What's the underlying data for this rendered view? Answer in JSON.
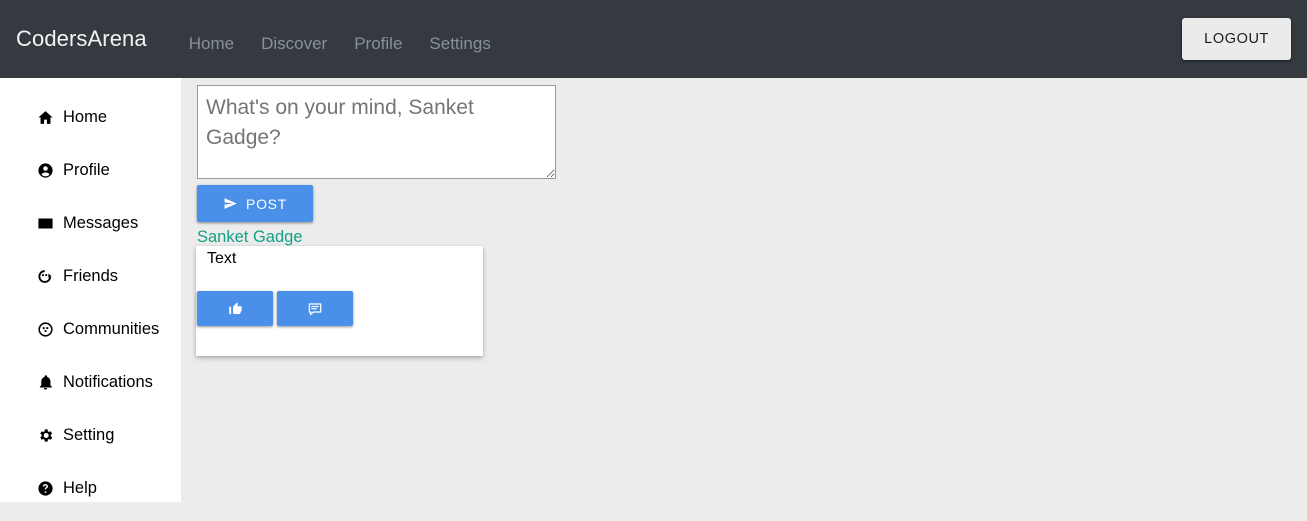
{
  "navbar": {
    "brand": "CodersArena",
    "links": [
      {
        "label": "Home",
        "icon": "none"
      },
      {
        "label": "Discover",
        "icon": "none"
      },
      {
        "label": "Profile",
        "icon": "none"
      },
      {
        "label": "Settings",
        "icon": "none"
      }
    ],
    "logout_label": "LOGOUT",
    "background_color": "#343a40",
    "link_color": "#8a9099",
    "brand_color": "#f2f3f4"
  },
  "sidebar": {
    "items": [
      {
        "label": "Home",
        "icon": "home-icon"
      },
      {
        "label": "Profile",
        "icon": "account-circle-icon"
      },
      {
        "label": "Messages",
        "icon": "envelope-icon"
      },
      {
        "label": "Friends",
        "icon": "friends-icon"
      },
      {
        "label": "Communities",
        "icon": "communities-icon"
      },
      {
        "label": "Notifications",
        "icon": "bell-icon"
      },
      {
        "label": "Setting",
        "icon": "gear-icon"
      },
      {
        "label": "Help",
        "icon": "help-circle-icon"
      }
    ],
    "background_color": "#ffffff"
  },
  "composer": {
    "placeholder": "What's on your mind, Sanket Gadge?",
    "value": "",
    "post_button_label": "POST",
    "post_button_icon": "send-icon",
    "accent_color": "#4a90e8"
  },
  "post": {
    "author": "Sanket Gadge",
    "author_color": "#16a085",
    "text": "Text",
    "actions": [
      {
        "name": "like",
        "icon": "thumbs-up-icon"
      },
      {
        "name": "comment",
        "icon": "comment-icon"
      }
    ]
  },
  "page": {
    "background_color": "#ececec"
  }
}
